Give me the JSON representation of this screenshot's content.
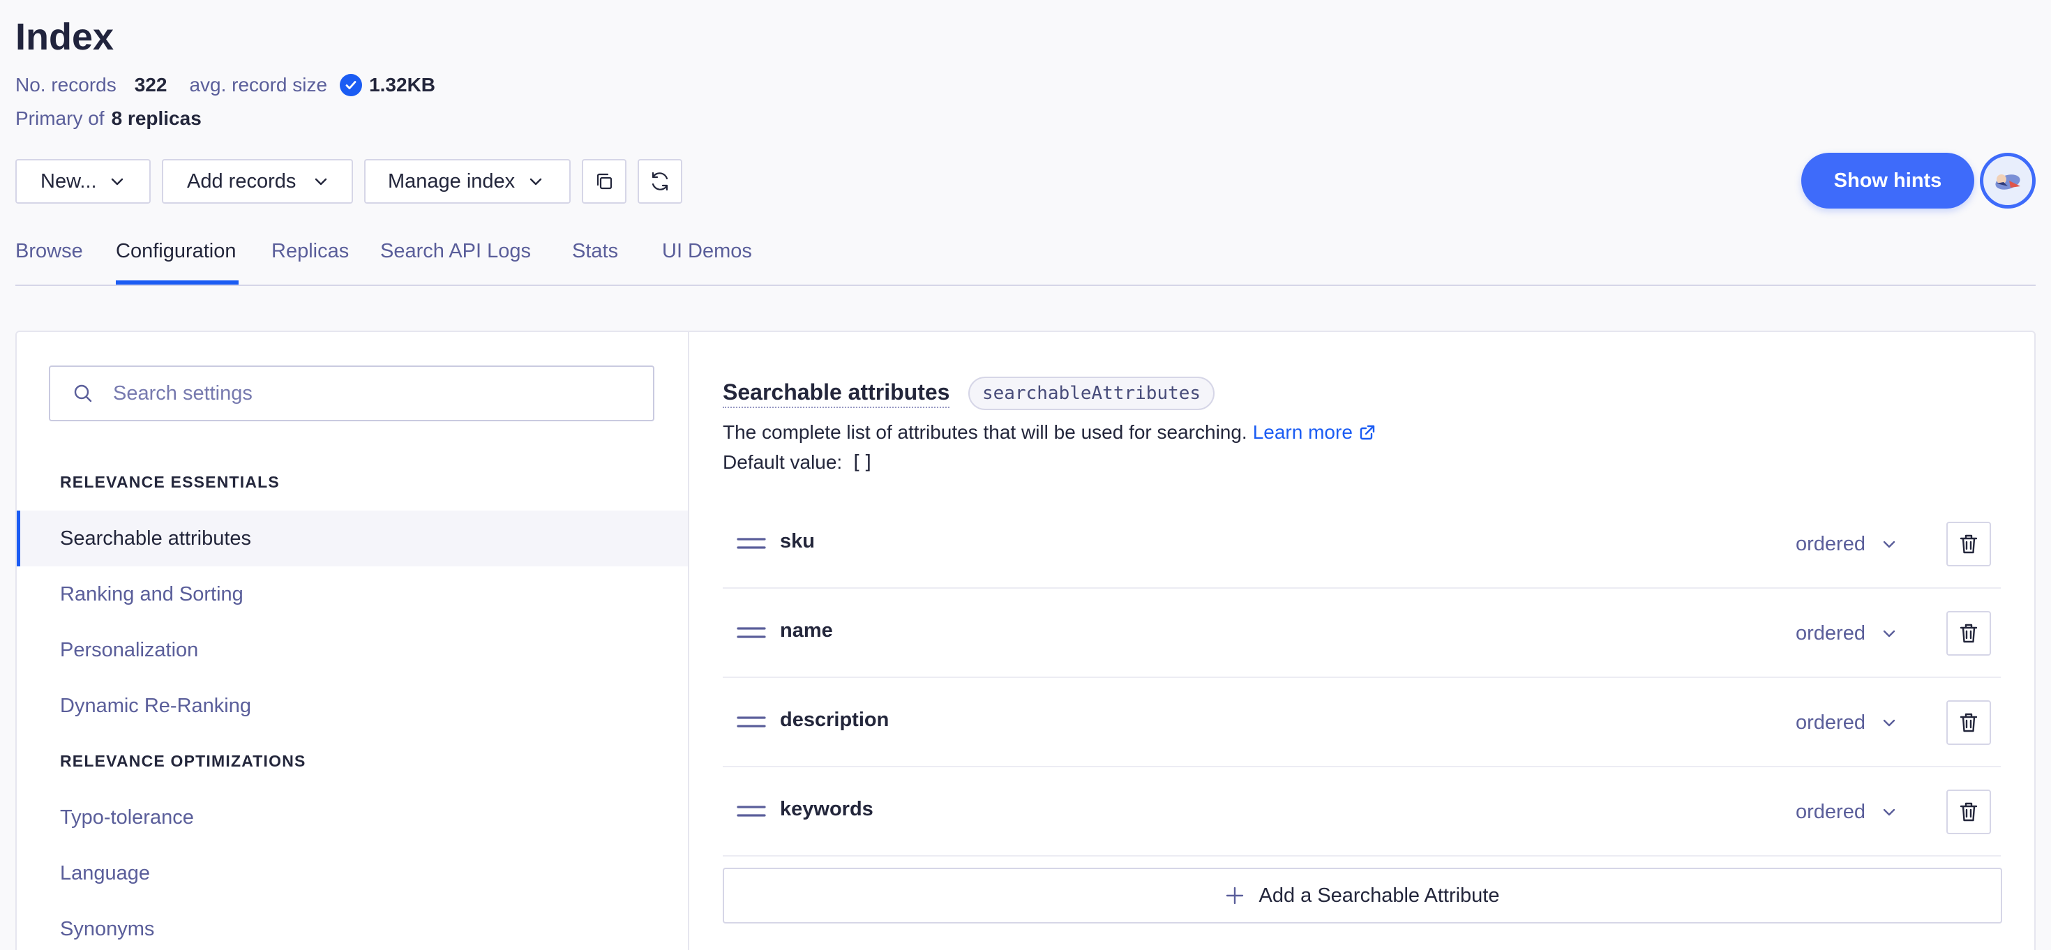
{
  "header": {
    "title": "Index",
    "records_label": "No. records",
    "records_value": "322",
    "avg_label": "avg. record size",
    "avg_value": "1.32KB",
    "primary_label": "Primary of",
    "replicas_value": "8 replicas"
  },
  "toolbar": {
    "new_label": "New...",
    "add_records_label": "Add records",
    "manage_index_label": "Manage index",
    "copy_icon": "copy-icon",
    "refresh_icon": "refresh-icon",
    "show_hints_label": "Show hints"
  },
  "tabs": [
    {
      "label": "Browse",
      "active": false
    },
    {
      "label": "Configuration",
      "active": true
    },
    {
      "label": "Replicas",
      "active": false
    },
    {
      "label": "Search API Logs",
      "active": false
    },
    {
      "label": "Stats",
      "active": false
    },
    {
      "label": "UI Demos",
      "active": false
    }
  ],
  "sidebar": {
    "search_placeholder": "Search settings",
    "section_essentials": "RELEVANCE ESSENTIALS",
    "items_essentials": [
      "Searchable attributes",
      "Ranking and Sorting",
      "Personalization",
      "Dynamic Re-Ranking"
    ],
    "section_optimizations": "RELEVANCE OPTIMIZATIONS",
    "items_optimizations": [
      "Typo-tolerance",
      "Language",
      "Synonyms"
    ],
    "active_item": "Searchable attributes"
  },
  "main": {
    "title": "Searchable attributes",
    "code_tag": "searchableAttributes",
    "description": "The complete list of attributes that will be used for searching.",
    "learn_more": "Learn more",
    "default_label": "Default value:",
    "default_value": "[]",
    "attributes": [
      {
        "name": "sku",
        "mode": "ordered"
      },
      {
        "name": "name",
        "mode": "ordered"
      },
      {
        "name": "description",
        "mode": "ordered"
      },
      {
        "name": "keywords",
        "mode": "ordered"
      }
    ],
    "add_label": "Add a Searchable Attribute"
  },
  "colors": {
    "accent": "#1b5cf3",
    "hints_button": "#3e6bfa",
    "muted_text": "#5a5e9a",
    "text": "#23263b"
  }
}
